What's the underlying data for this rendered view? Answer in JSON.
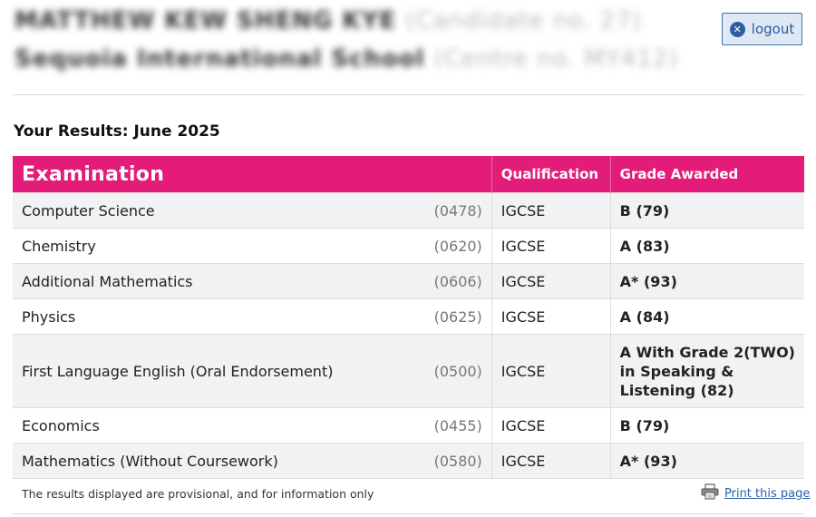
{
  "candidate": {
    "name": "MATTHEW KEW SHENG KYE",
    "candidate_no": "(Candidate no. 27)",
    "school": "Sequoia International School",
    "centre_no": "(Centre no. MY412)"
  },
  "logout": {
    "label": "logout",
    "icon": "close-circle-icon"
  },
  "results_heading": "Your Results: June 2025",
  "table": {
    "headers": {
      "examination": "Examination",
      "qualification": "Qualification",
      "grade": "Grade Awarded"
    },
    "rows": [
      {
        "subject": "Computer Science",
        "code": "(0478)",
        "qualification": "IGCSE",
        "grade": "B (79)"
      },
      {
        "subject": "Chemistry",
        "code": "(0620)",
        "qualification": "IGCSE",
        "grade": "A (83)"
      },
      {
        "subject": "Additional Mathematics",
        "code": "(0606)",
        "qualification": "IGCSE",
        "grade": "A* (93)"
      },
      {
        "subject": "Physics",
        "code": "(0625)",
        "qualification": "IGCSE",
        "grade": "A (84)"
      },
      {
        "subject": "First Language English (Oral Endorsement)",
        "code": "(0500)",
        "qualification": "IGCSE",
        "grade": "A With Grade 2(TWO) in Speaking & Listening (82)"
      },
      {
        "subject": "Economics",
        "code": "(0455)",
        "qualification": "IGCSE",
        "grade": "B (79)"
      },
      {
        "subject": "Mathematics (Without Coursework)",
        "code": "(0580)",
        "qualification": "IGCSE",
        "grade": "A* (93)"
      }
    ]
  },
  "footer": {
    "disclaimer": "The results displayed are provisional, and for information only",
    "print_label": "Print this page",
    "print_icon": "printer-icon"
  },
  "colors": {
    "header_pink": "#e31c79",
    "link_blue": "#2a62ae",
    "logout_bg": "#dfe9f5"
  }
}
